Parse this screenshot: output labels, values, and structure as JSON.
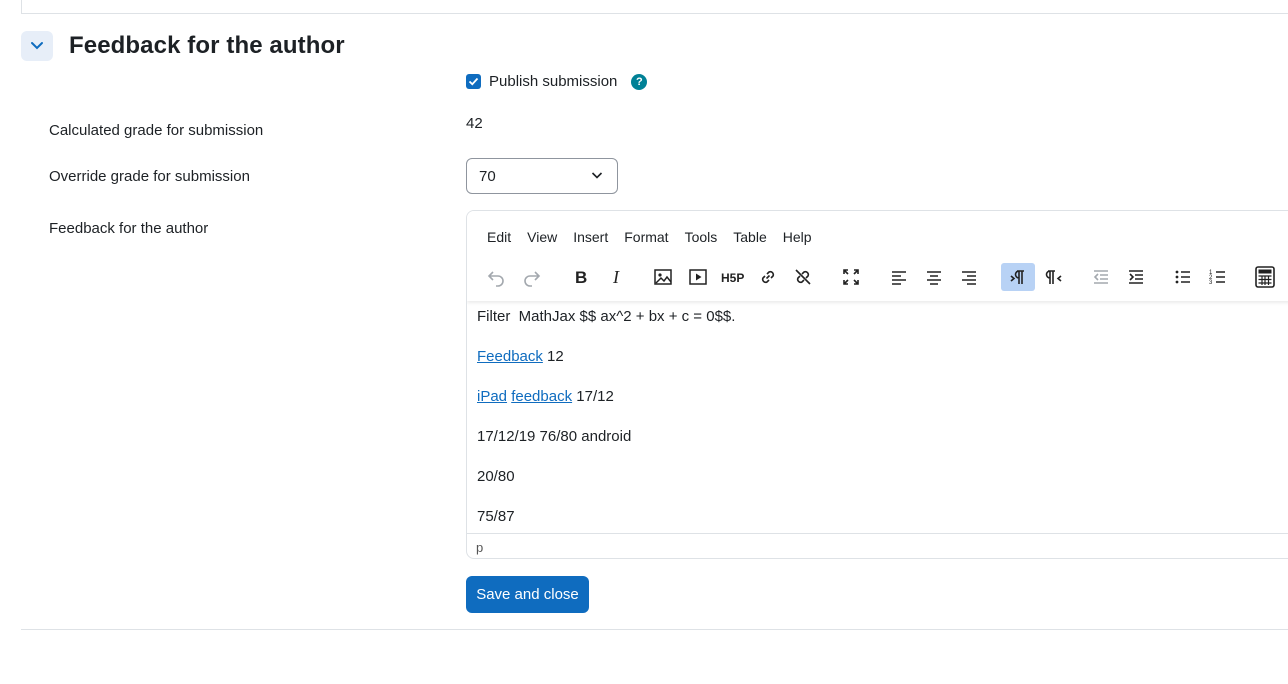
{
  "section": {
    "title": "Feedback for the author"
  },
  "publish": {
    "label": "Publish submission",
    "checked": true,
    "help": "?"
  },
  "fields": {
    "calculated_label": "Calculated grade for submission",
    "calculated_value": "42",
    "override_label": "Override grade for submission",
    "override_value": "70",
    "feedback_label": "Feedback for the author"
  },
  "editor": {
    "menus": [
      "Edit",
      "View",
      "Insert",
      "Format",
      "Tools",
      "Table",
      "Help"
    ],
    "statusbar": "p",
    "content": {
      "line1": "Filter  MathJax $$ ax^2 + bx + c = 0$$.",
      "line2_link": "Feedback",
      "line2_text": " 12",
      "line3_link1": "iPad",
      "line3_link2": "feedback",
      "line3_text": " 17/12",
      "line4": "17/12/19 76/80 android",
      "line5": "20/80",
      "line6": "75/87"
    }
  },
  "save_button": "Save and close",
  "colors": {
    "primary": "#0f6cbf",
    "help": "#008196",
    "active_tool": "#b8d2f5"
  }
}
